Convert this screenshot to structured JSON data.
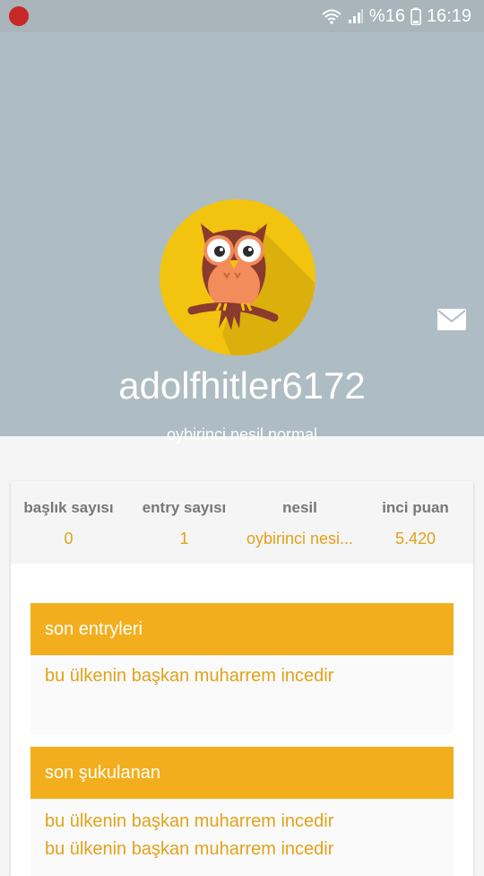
{
  "status": {
    "battery_text": "%16",
    "time": "16:19"
  },
  "profile": {
    "username": "adolfhitler6172",
    "generation": "oybirinci nesil normal"
  },
  "stats": [
    {
      "label": "başlık sayısı",
      "value": "0"
    },
    {
      "label": "entry sayısı",
      "value": "1"
    },
    {
      "label": "nesil",
      "value": "oybirinci nesi..."
    },
    {
      "label": "inci puan",
      "value": "5.420"
    }
  ],
  "sections": {
    "recent_entries": {
      "title": "son entryleri",
      "items": [
        "bu ülkenin başkan muharrem incedir"
      ]
    },
    "recent_likes": {
      "title": "son şukulanan",
      "items": [
        "bu ülkenin başkan muharrem incedir",
        "bu ülkenin başkan muharrem incedir"
      ]
    }
  },
  "colors": {
    "header": "#aebcc3",
    "accent": "#f2ae1c",
    "accent_text": "#e2a21a",
    "avatar_bg": "#f2c40f"
  },
  "icons": [
    "app-icon",
    "wifi-icon",
    "signal-icon",
    "battery-icon",
    "mail-icon",
    "owl-avatar-icon"
  ]
}
